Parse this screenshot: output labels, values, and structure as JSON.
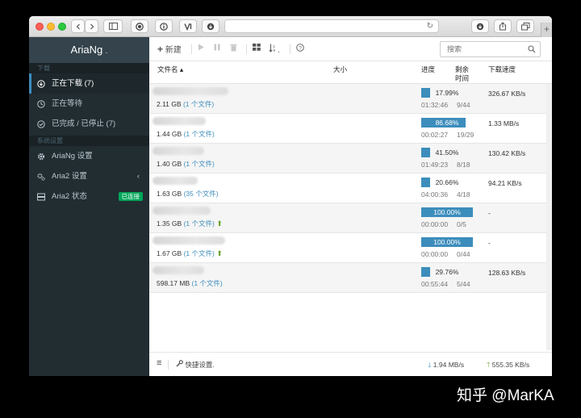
{
  "app": {
    "name": "AriaNg",
    "name_suffix": "."
  },
  "sidebar": {
    "section_download": "下载",
    "items": [
      {
        "label": "正在下载 (7)",
        "icon": "download-circle-icon"
      },
      {
        "label": "正在等待",
        "icon": "clock-icon"
      },
      {
        "label": "已完成 / 已停止 (7)",
        "icon": "check-circle-icon"
      }
    ],
    "section_settings": "系统设置",
    "settings_items": [
      {
        "label": "AriaNg 设置",
        "icon": "gear-icon"
      },
      {
        "label": "Aria2 设置",
        "icon": "gears-icon",
        "chevron": "‹"
      },
      {
        "label": "Aria2 状态",
        "icon": "server-icon",
        "badge": "已连接"
      }
    ]
  },
  "toolbar": {
    "new_label": "新建",
    "sort_suffix": ".",
    "search_placeholder": "搜索"
  },
  "table": {
    "columns": {
      "name": "文件名 ▴",
      "size": "大小",
      "progress": "进度",
      "remaining": "剩余\n时间",
      "speed": "下载速度"
    },
    "rows": [
      {
        "size": "2.11 GB",
        "files": "(1 个文件)",
        "seeding": false,
        "progress": 17.99,
        "progress_text": "17.99%",
        "remaining": "01:32:46",
        "connections": "9/44",
        "speed": "326.67 KB/s"
      },
      {
        "size": "1.44 GB",
        "files": "(1 个文件)",
        "seeding": false,
        "progress": 86.68,
        "progress_text": "86.68%",
        "remaining": "00:02:27",
        "connections": "19/29",
        "speed": "1.33 MB/s"
      },
      {
        "size": "1.40 GB",
        "files": "(1 个文件)",
        "seeding": false,
        "progress": 41.5,
        "progress_text": "41.50%",
        "remaining": "01:49:23",
        "connections": "8/18",
        "speed": "130.42 KB/s"
      },
      {
        "size": "1.63 GB",
        "files": "(35 个文件)",
        "seeding": false,
        "progress": 20.66,
        "progress_text": "20.66%",
        "remaining": "04:00:36",
        "connections": "4/18",
        "speed": "94.21 KB/s"
      },
      {
        "size": "1.35 GB",
        "files": "(1 个文件)",
        "seeding": true,
        "seed_glyph": "⬆",
        "progress": 100,
        "progress_text": "100.00%",
        "remaining": "00:00:00",
        "connections": "0/5",
        "speed": "-"
      },
      {
        "size": "1.67 GB",
        "files": "(1 个文件)",
        "seeding": true,
        "seed_glyph": "⬆",
        "progress": 100,
        "progress_text": "100.00%",
        "remaining": "00:00:00",
        "connections": "0/44",
        "speed": "-"
      },
      {
        "size": "598.17 MB",
        "files": "(1 个文件)",
        "seeding": false,
        "progress": 29.76,
        "progress_text": "29.76%",
        "remaining": "00:55:44",
        "connections": "5/44",
        "speed": "128.63 KB/s"
      }
    ]
  },
  "footer": {
    "menu_icon": "≡",
    "quick_settings": "快捷设置",
    "quick_suffix": ".",
    "down_arrow": "🡓",
    "down_speed": "1.94 MB/s",
    "up_arrow": "🡑",
    "up_speed": "555.35 KB/s"
  },
  "watermark": "知乎 @MarKA",
  "colors": {
    "sidebar": "#222d32",
    "accent": "#3c8dbc",
    "badge": "#00a65a",
    "seed": "#6aa22c"
  }
}
